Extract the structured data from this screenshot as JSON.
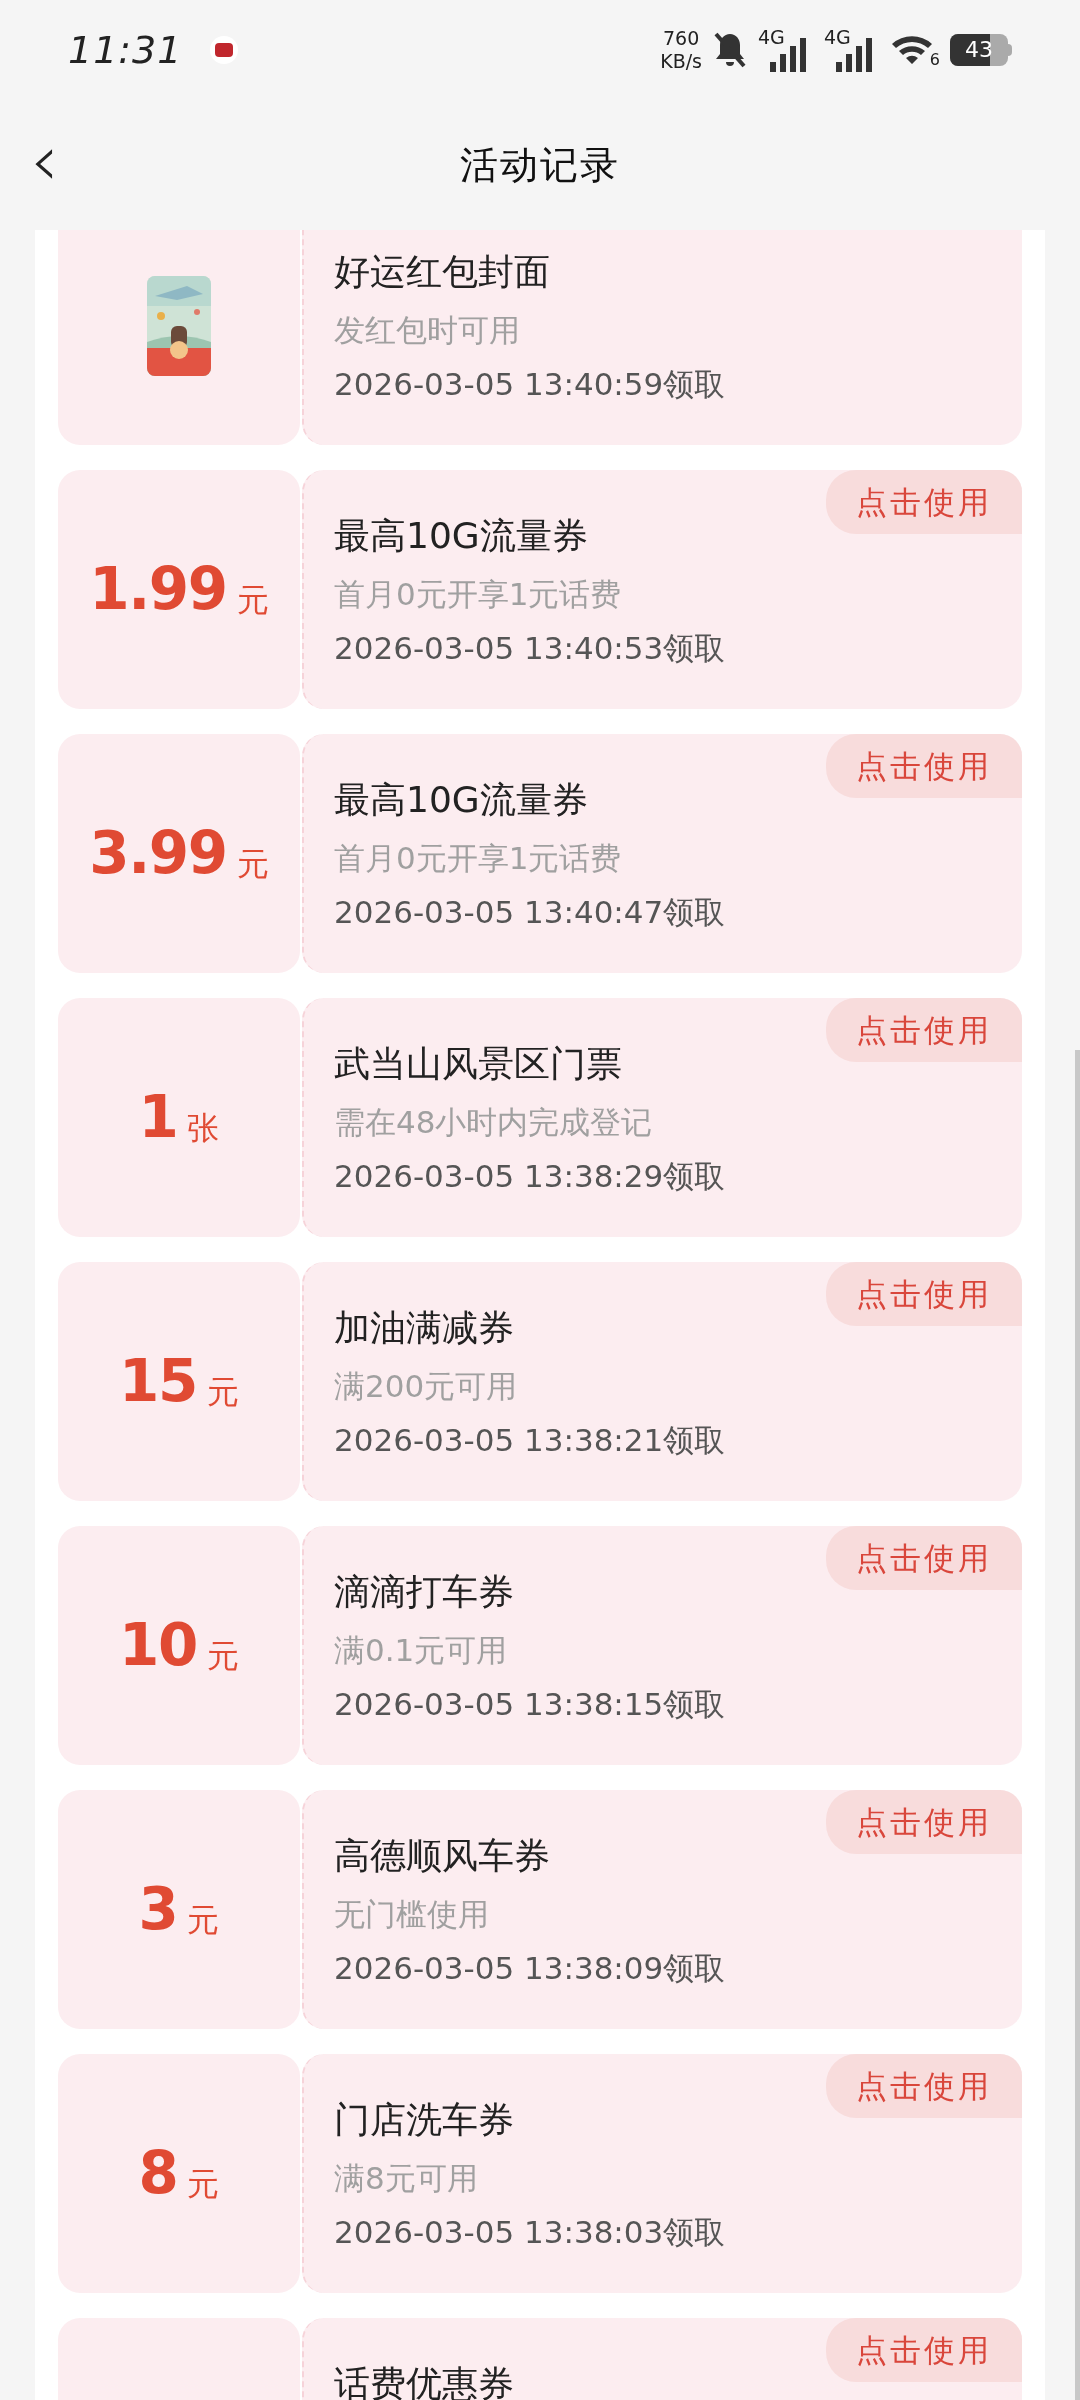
{
  "status_bar": {
    "time": "11:31",
    "speed_value": "760",
    "speed_unit": "KB/s",
    "network_1": "4G",
    "network_2": "4G",
    "wifi_label": "6",
    "battery": "43"
  },
  "header": {
    "back": "‹",
    "title": "活动记录"
  },
  "records": [
    {
      "kind": "picture",
      "title": "好运红包封面",
      "condition": "发红包时可用",
      "time": "2026-03-05 13:40:59领取"
    },
    {
      "kind": "value",
      "amount": "1.99",
      "unit": "元",
      "title": "最高10G流量券",
      "condition": "首月0元开享1元话费",
      "time": "2026-03-05 13:40:53领取",
      "action": "点击使用"
    },
    {
      "kind": "value",
      "amount": "3.99",
      "unit": "元",
      "title": "最高10G流量券",
      "condition": "首月0元开享1元话费",
      "time": "2026-03-05 13:40:47领取",
      "action": "点击使用"
    },
    {
      "kind": "value",
      "amount": "1",
      "unit": "张",
      "title": "武当山风景区门票",
      "condition": "需在48小时内完成登记",
      "time": "2026-03-05 13:38:29领取",
      "action": "点击使用"
    },
    {
      "kind": "value",
      "amount": "15",
      "unit": "元",
      "title": "加油满减券",
      "condition": "满200元可用",
      "time": "2026-03-05 13:38:21领取",
      "action": "点击使用"
    },
    {
      "kind": "value",
      "amount": "10",
      "unit": "元",
      "title": "滴滴打车券",
      "condition": "满0.1元可用",
      "time": "2026-03-05 13:38:15领取",
      "action": "点击使用"
    },
    {
      "kind": "value",
      "amount": "3",
      "unit": "元",
      "title": "高德顺风车券",
      "condition": "无门槛使用",
      "time": "2026-03-05 13:38:09领取",
      "action": "点击使用"
    },
    {
      "kind": "value",
      "amount": "8",
      "unit": "元",
      "title": "门店洗车券",
      "condition": "满8元可用",
      "time": "2026-03-05 13:38:03领取",
      "action": "点击使用"
    },
    {
      "kind": "partial",
      "title": "话费优惠券",
      "action": "点击使用"
    }
  ]
}
